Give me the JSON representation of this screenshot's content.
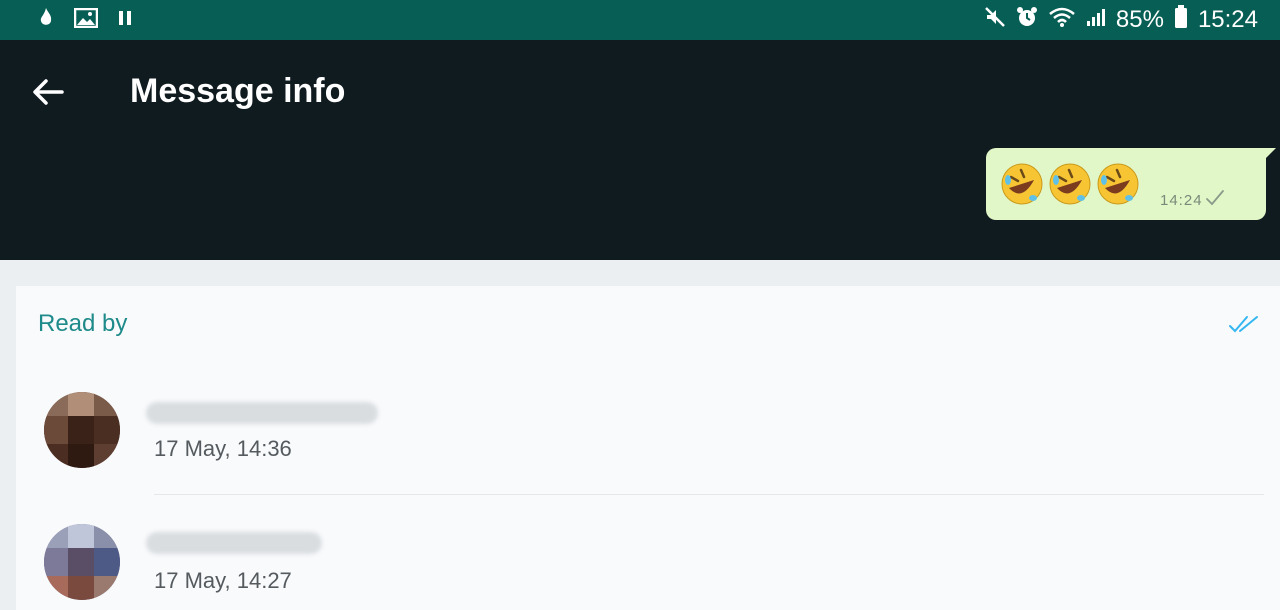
{
  "status_bar": {
    "battery": "85%",
    "clock": "15:24",
    "icons_left": [
      "flame-notification-icon",
      "gallery-icon",
      "pause-icon"
    ],
    "icons_right": [
      "mute-icon",
      "alarm-icon",
      "wifi-icon",
      "signal-icon",
      "battery-icon"
    ]
  },
  "header": {
    "title": "Message info",
    "back_icon": "arrow-left-icon"
  },
  "message": {
    "emojis": [
      "rolling-on-floor-laughing-emoji",
      "rolling-on-floor-laughing-emoji",
      "rolling-on-floor-laughing-emoji"
    ],
    "time": "14:24",
    "status_icon": "single-check-icon"
  },
  "read_by": {
    "label": "Read by",
    "status_icon": "double-check-icon",
    "contacts": [
      {
        "time": "17 May, 14:36"
      },
      {
        "time": "17 May, 14:27"
      }
    ]
  },
  "colors": {
    "status_bar": "#075e54",
    "app_bar": "#101b20",
    "bubble": "#e2f7c8",
    "accent": "#1f8a8a",
    "read_check": "#34b7f1"
  }
}
